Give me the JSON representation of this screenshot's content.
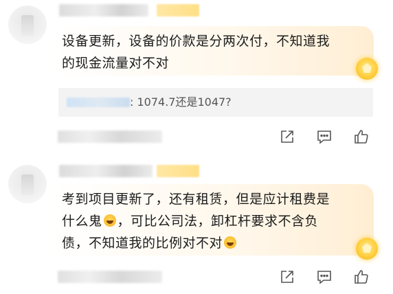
{
  "comments": [
    {
      "text_line1": "设备更新，设备的价款是分两次付，不知道我",
      "text_line2": "的现金流量对不对",
      "reply_preview": ": 1074.7还是1047?"
    },
    {
      "text_line1": "考到项目更新了，还有租赁，但是应计租费是",
      "text_line2a": "什么鬼",
      "text_line2b": "，可比公司法，卸杠杆要求不含负",
      "text_line3": "债，不知道我的比例对不对"
    }
  ],
  "icons": {
    "share": "share-icon",
    "comment": "comment-icon",
    "like": "thumbs-up-icon",
    "badge": "pentagon-badge-icon",
    "emoji_laugh": "laughing-emoji-icon"
  },
  "colors": {
    "bubble_tint": "#fff3dc",
    "reply_bg": "#f3f3f3",
    "icon": "#555555",
    "tag": "#ffdf86"
  }
}
